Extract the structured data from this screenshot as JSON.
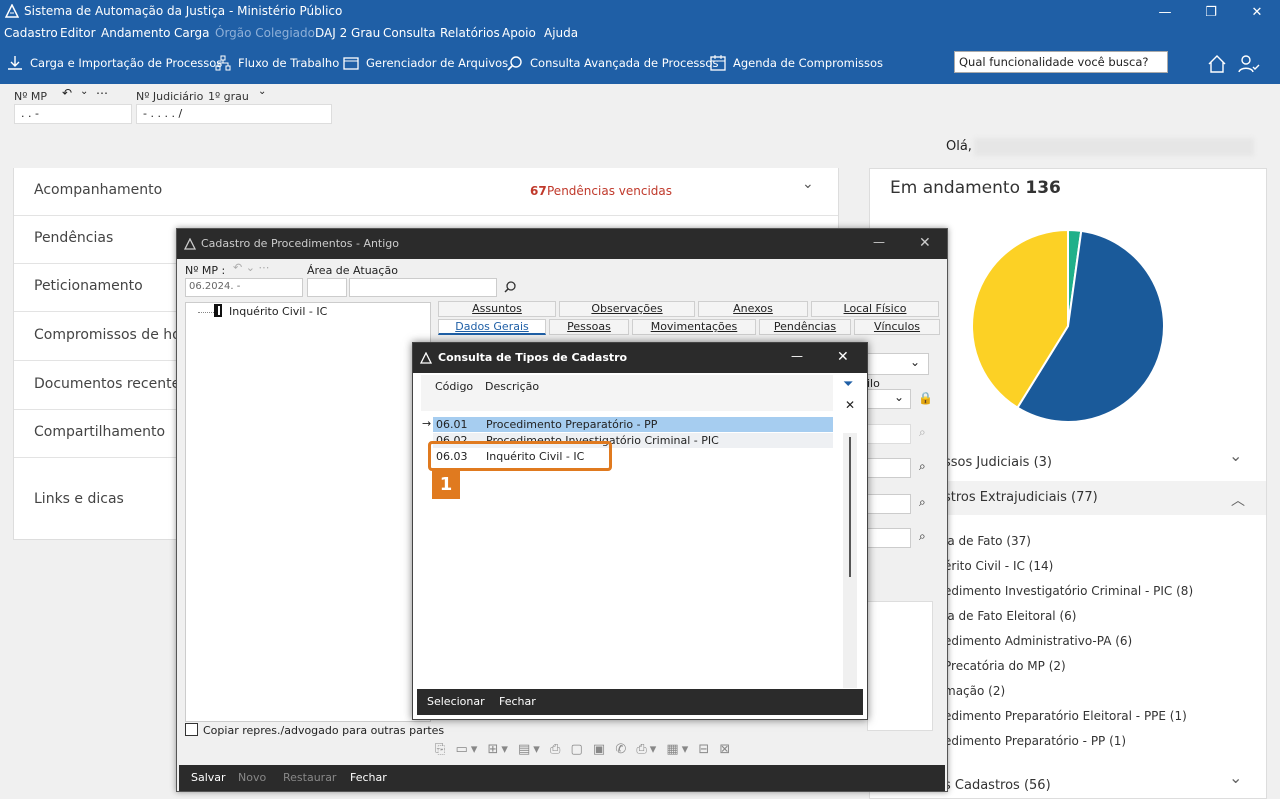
{
  "app": {
    "title": "Sistema de Automação da Justiça - Ministério Público"
  },
  "menu": [
    "Cadastro",
    "Editor",
    "Andamento",
    "Carga",
    "Órgão Colegiado",
    "DAJ 2 Grau",
    "Consulta",
    "Relatórios",
    "Apoio",
    "Ajuda"
  ],
  "toolbar": {
    "items": [
      "Carga e Importação de Processos",
      "Fluxo de Trabalho",
      "Gerenciador de Arquivos",
      "Consulta Avançada de Processos",
      "Agenda de Compromissos"
    ],
    "search_placeholder": "Qual funcionalidade você busca?"
  },
  "header_fields": {
    "nmp_label": "Nº MP",
    "nmp_value": ". .       -",
    "njud_label": "Nº Judiciário",
    "grau": "1º grau",
    "njud_value": "-  . .  .  .      /"
  },
  "greeting": "Olá,",
  "accordion": {
    "items": [
      "Acompanhamento",
      "Pendências",
      "Peticionamento",
      "Compromissos de hoje",
      "Documentos recentes",
      "Compartilhamento",
      "Links e dicas"
    ],
    "pend_count": "67",
    "pend_text": "Pendências vencidas"
  },
  "right_panel": {
    "title": "Em andamento",
    "count": "136",
    "sec1": "ssos Judiciais (3)",
    "sec2": "stros Extrajudiciais (77)",
    "items": [
      "ia de Fato (37)",
      "érito Civil - IC (14)",
      "edimento Investigatório Criminal - PIC (8)",
      "ia de Fato Eleitoral (6)",
      "edimento Administrativo-PA (6)",
      "Precatória do MP (2)",
      "mação (2)",
      "edimento Preparatório Eleitoral - PPE (1)",
      "edimento Preparatório - PP (1)"
    ],
    "sec3": "s Cadastros (56)"
  },
  "pie": {
    "slices": [
      {
        "label": "Judiciais",
        "value": 3,
        "color": "#20b08a"
      },
      {
        "label": "Extrajudiciais",
        "value": 77,
        "color": "#1a5a9a"
      },
      {
        "label": "Cadastros",
        "value": 56,
        "color": "#fcd125"
      }
    ]
  },
  "win1": {
    "title": "Cadastro de Procedimentos - Antigo",
    "nmp_label": "Nº MP :",
    "area_label": "Área de Atuação",
    "nmp_value": "06.2024.        -",
    "tree_item": "Inquérito Civil - IC",
    "tabs_top": [
      "Assuntos",
      "Observações",
      "Anexos",
      "Local Físico"
    ],
    "tabs_bottom": [
      "Dados Gerais",
      "Pessoas",
      "Movimentações",
      "Pendências",
      "Vínculos"
    ],
    "partial_lbl": "ilo",
    "copy_label": "Copiar repres./advogado para outras partes",
    "buttons": [
      "Salvar",
      "Novo",
      "Restaurar",
      "Fechar"
    ]
  },
  "win2": {
    "title": "Consulta de Tipos de Cadastro",
    "col_code": "Código",
    "col_desc": "Descrição",
    "rows": [
      {
        "code": "06.01",
        "desc": "Procedimento Preparatório - PP"
      },
      {
        "code": "06.02",
        "desc": "Procedimento Investigatório Criminal - PIC"
      },
      {
        "code": "06.03",
        "desc": "Inquérito Civil - IC"
      }
    ],
    "select_label": "Selecionar",
    "close_label": "Fechar"
  },
  "badge": "1"
}
